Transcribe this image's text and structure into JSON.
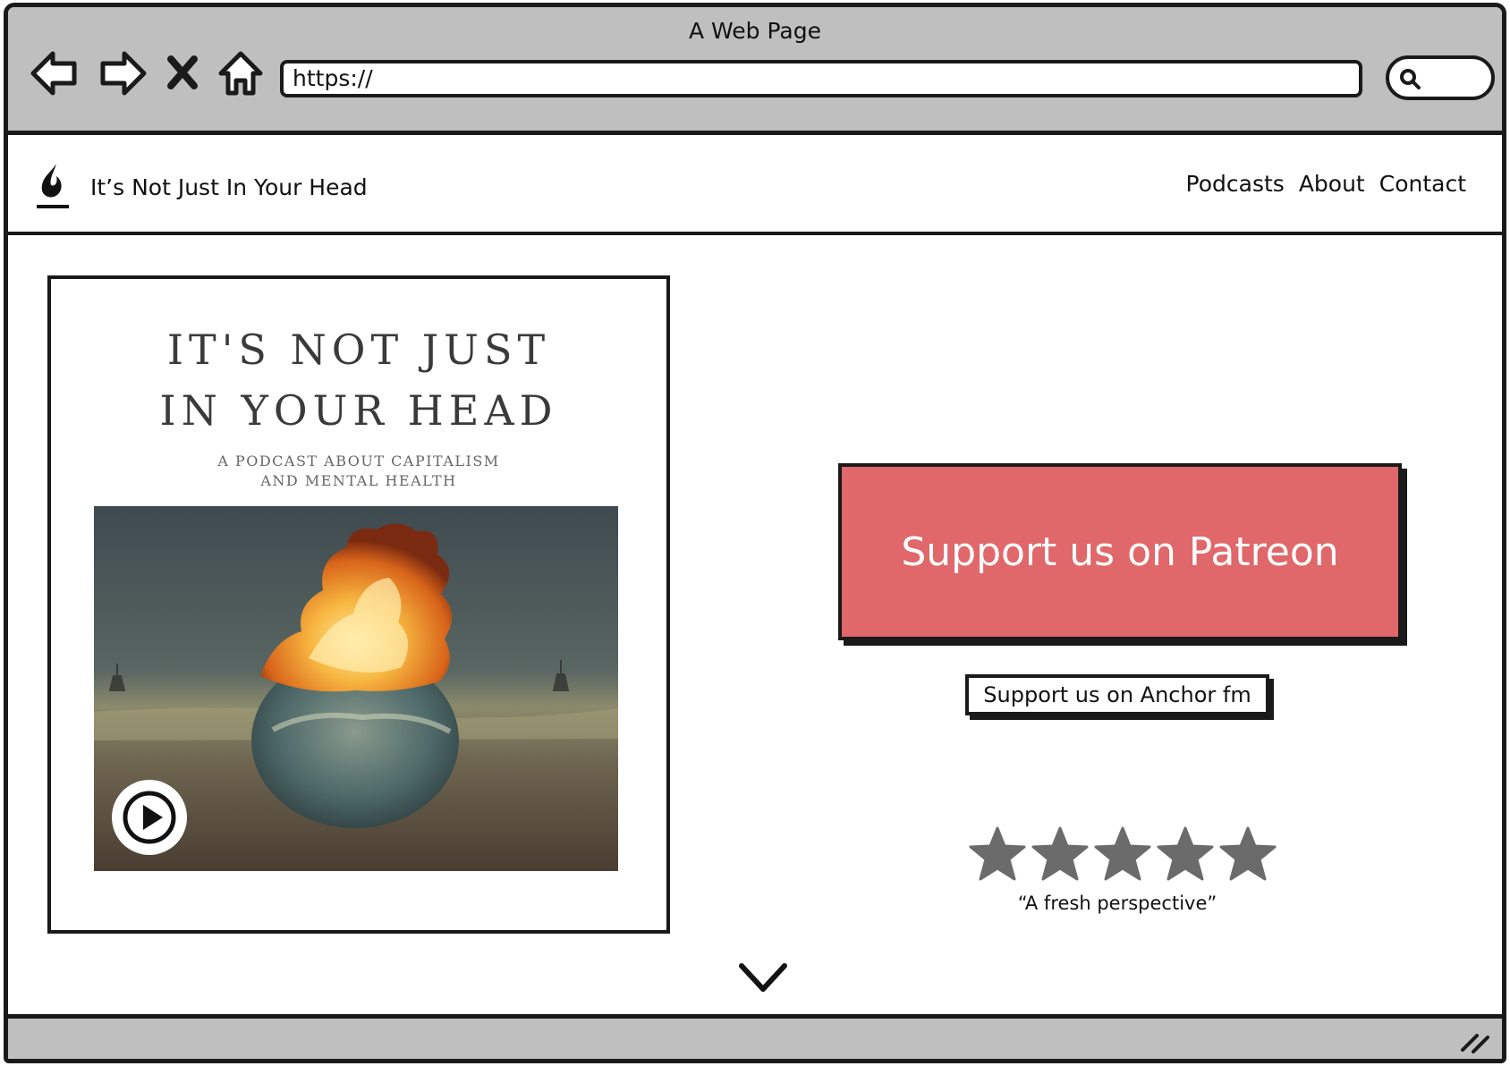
{
  "browser": {
    "window_title": "A Web Page",
    "url": "https://",
    "nav_icons": [
      "back-arrow-icon",
      "forward-arrow-icon",
      "stop-icon",
      "home-icon"
    ],
    "search_icon": "search-icon"
  },
  "site": {
    "logo_icon": "flame-logo-icon",
    "title": "It’s Not Just In Your Head",
    "nav": [
      {
        "label": "Podcasts"
      },
      {
        "label": "About"
      },
      {
        "label": "Contact"
      }
    ]
  },
  "cover": {
    "title_line1": "IT'S NOT JUST",
    "title_line2": "IN YOUR HEAD",
    "subtitle_line1": "A PODCAST ABOUT CAPITALISM",
    "subtitle_line2": "AND MENTAL HEALTH",
    "play_icon": "play-icon"
  },
  "actions": {
    "patreon_label": "Support us on Patreon",
    "anchor_label": "Support us on Anchor fm"
  },
  "rating": {
    "stars": 5,
    "max": 5,
    "quote": "“A fresh perspective”"
  },
  "colors": {
    "patreon": "#e0676a",
    "chrome": "#bfbfbf",
    "star": "#6b6b6b"
  }
}
